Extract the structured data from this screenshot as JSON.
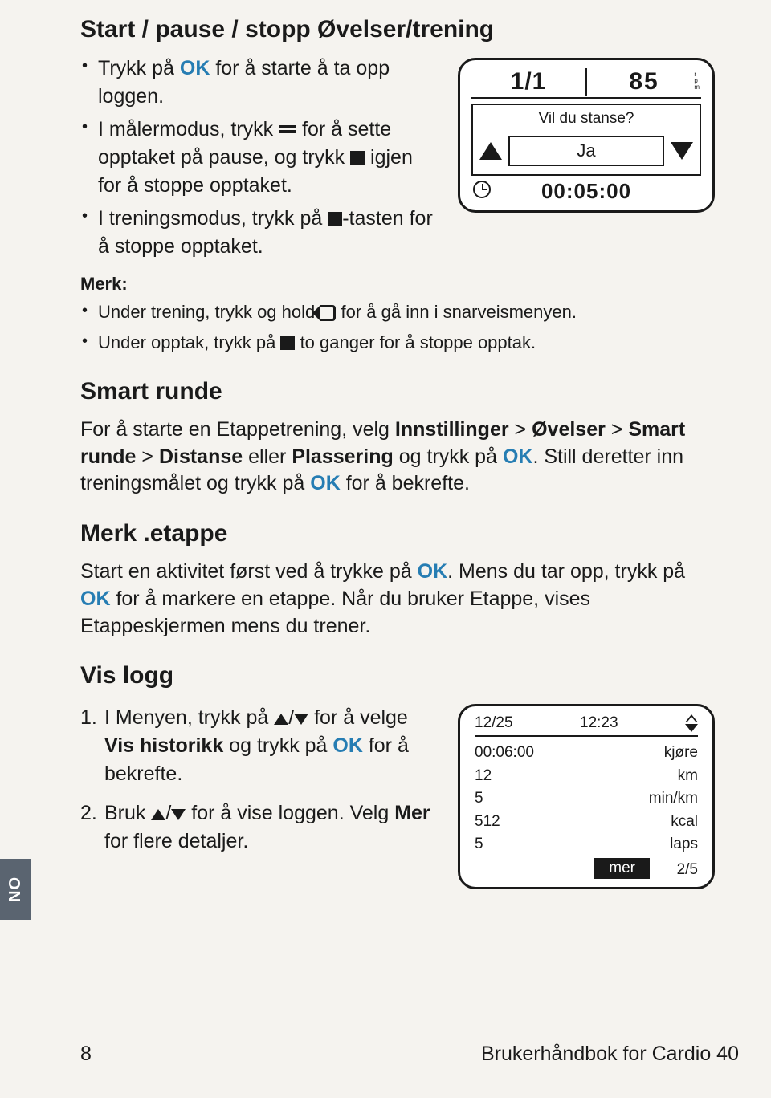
{
  "section1": {
    "title": "Start / pause / stopp Øvelser/trening",
    "b1_pre": "Trykk på ",
    "b1_ok": "OK",
    "b1_post": " for å starte å ta opp loggen.",
    "b2_pre": "I målermodus, trykk ",
    "b2_mid": " for å sette opptaket på pause, og trykk ",
    "b2_post": " igjen for å stoppe opptaket.",
    "b3_pre": "I treningsmodus, trykk på ",
    "b3_post": "-tasten for å stoppe opptaket.",
    "note_label": "Merk:",
    "n1_pre": "Under trening, trykk og hold ",
    "n1_post": " for å gå inn i snarveismenyen.",
    "n2_pre": "Under opptak, trykk på ",
    "n2_post": " to ganger for å stoppe opptak."
  },
  "dev1": {
    "frac": "1/1",
    "rpm": "85",
    "rpm_unit_r": "r",
    "rpm_unit_p": "p",
    "rpm_unit_m": "m",
    "question": "Vil du stanse?",
    "ja": "Ja",
    "time": "00:05:00"
  },
  "section2": {
    "title": "Smart runde",
    "p_pre": "For å starte en Etappetrening, velg ",
    "s1": "Innstillinger",
    "gt1": " > ",
    "s2": "Øvelser",
    "gt2": " > ",
    "s3": "Smart runde",
    "gt3": " > ",
    "s4": "Distanse",
    "eller": " eller ",
    "s5": "Plassering",
    "mid": " og trykk på ",
    "ok1": "OK",
    "mid2": ". Still deretter inn treningsmålet og trykk på ",
    "ok2": "OK",
    "post": " for å bekrefte."
  },
  "section3": {
    "title": "Merk .etappe",
    "p_pre": "Start en aktivitet først ved å trykke på ",
    "ok1": "OK",
    "mid": ". Mens du tar opp, trykk på ",
    "ok2": "OK",
    "post": " for å markere en etappe. Når du bruker Etappe, vises Etappeskjermen mens du trener."
  },
  "section4": {
    "title": "Vis logg",
    "n1": "1.",
    "i1_pre": "I Menyen, trykk på ",
    "i1_mid": " for å velge ",
    "i1_bold": "Vis historikk",
    "i1_mid2": " og trykk på ",
    "i1_ok": "OK",
    "i1_post": " for å bekrefte.",
    "n2": "2.",
    "i2_pre": "Bruk ",
    "i2_mid": " for å vise loggen. Velg ",
    "i2_bold": "Mer",
    "i2_post": " for flere detaljer."
  },
  "dev2": {
    "date": "12/25",
    "time": "12:23",
    "r1l": "00:06:00",
    "r1r": "kjøre",
    "r2l": "12",
    "r2r": "km",
    "r3l": "5",
    "r3r": "min/km",
    "r4l": "512",
    "r4r": "kcal",
    "r5l": "5",
    "r5r": "laps",
    "mer": "mer",
    "page": "2/5"
  },
  "sidetab": "NO",
  "footer": {
    "page": "8",
    "doc": "Brukerhåndbok for Cardio 40"
  }
}
